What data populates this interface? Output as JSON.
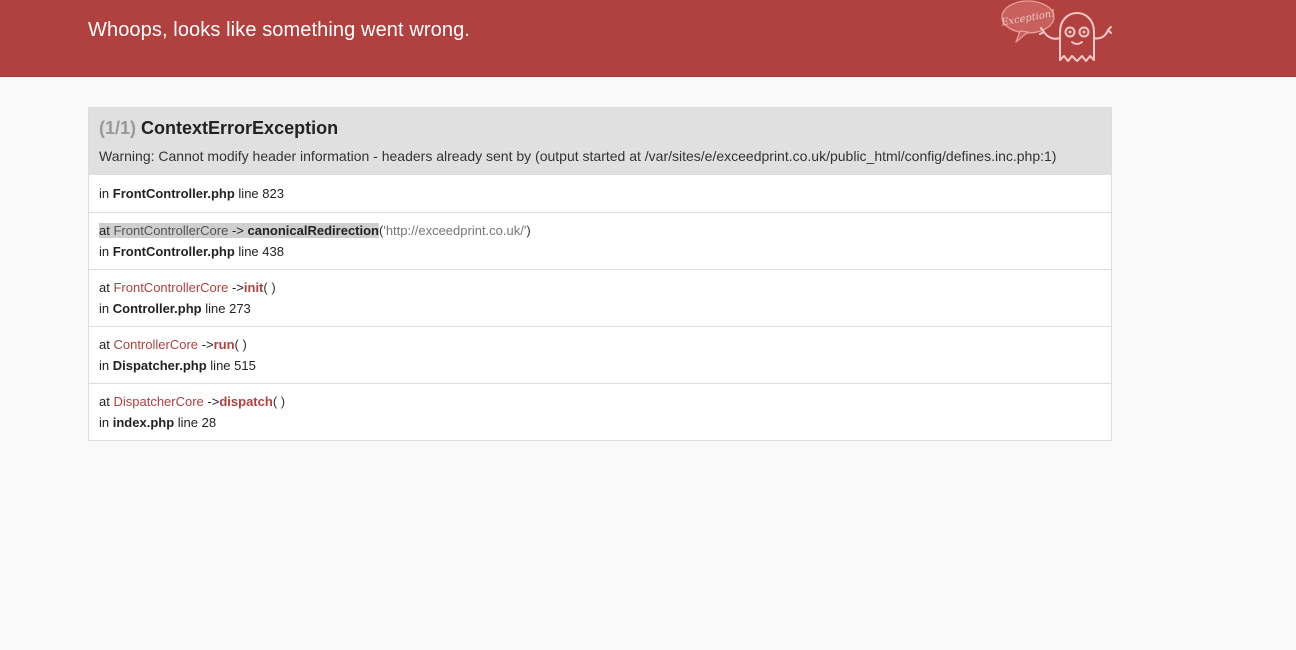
{
  "header": {
    "title": "Whoops, looks like something went wrong.",
    "logo_text": "Exception!"
  },
  "exception": {
    "count": "(1/1)",
    "name": "ContextErrorException",
    "message": "Warning: Cannot modify header information - headers already sent by (output started at /var/sites/e/exceedprint.co.uk/public_html/config/defines.inc.php:1)"
  },
  "trace": [
    {
      "in_prefix": "in",
      "file": "FrontController.php",
      "line_prefix": "line",
      "line": "823"
    },
    {
      "at_prefix": "at",
      "class": "FrontControllerCore",
      "arrow": "->",
      "method": "canonicalRedirection",
      "arg": "'http://exceedprint.co.uk/'",
      "in_prefix": "in",
      "file": "FrontController.php",
      "line_prefix": "line",
      "line": "438"
    },
    {
      "at_prefix": "at",
      "class": "FrontControllerCore",
      "arrow": "->",
      "method": "init",
      "in_prefix": "in",
      "file": "Controller.php",
      "line_prefix": "line",
      "line": "273"
    },
    {
      "at_prefix": "at",
      "class": "ControllerCore",
      "arrow": "->",
      "method": "run",
      "in_prefix": "in",
      "file": "Dispatcher.php",
      "line_prefix": "line",
      "line": "515"
    },
    {
      "at_prefix": "at",
      "class": "DispatcherCore",
      "arrow": "->",
      "method": "dispatch",
      "in_prefix": "in",
      "file": "index.php",
      "line_prefix": "line",
      "line": "28"
    }
  ],
  "colors": {
    "header_bg": "#b0413e",
    "accent": "#b0413e"
  }
}
